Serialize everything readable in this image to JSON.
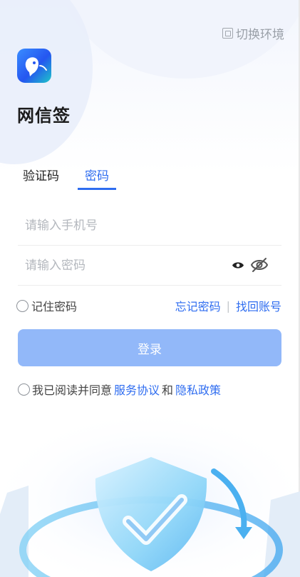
{
  "header": {
    "switch_env_label": "切换环境",
    "switch_env_icon": "switch-icon"
  },
  "app": {
    "name": "网信签",
    "logo_icon": "bird-logo-icon"
  },
  "tabs": [
    {
      "label": "验证码",
      "active": false
    },
    {
      "label": "密码",
      "active": true
    }
  ],
  "form": {
    "phone_placeholder": "请输入手机号",
    "phone_value": "",
    "password_placeholder": "请输入密码",
    "password_value": "",
    "remember_label": "记住密码",
    "forgot_label": "忘记密码",
    "separator": "|",
    "recover_label": "找回账号",
    "login_label": "登录"
  },
  "agreement": {
    "prefix": "我已阅读并同意",
    "service_label": "服务协议",
    "conjunction": "和",
    "privacy_label": "隐私政策"
  },
  "colors": {
    "accent": "#2f6df0",
    "login_button": "#92b8f9"
  }
}
